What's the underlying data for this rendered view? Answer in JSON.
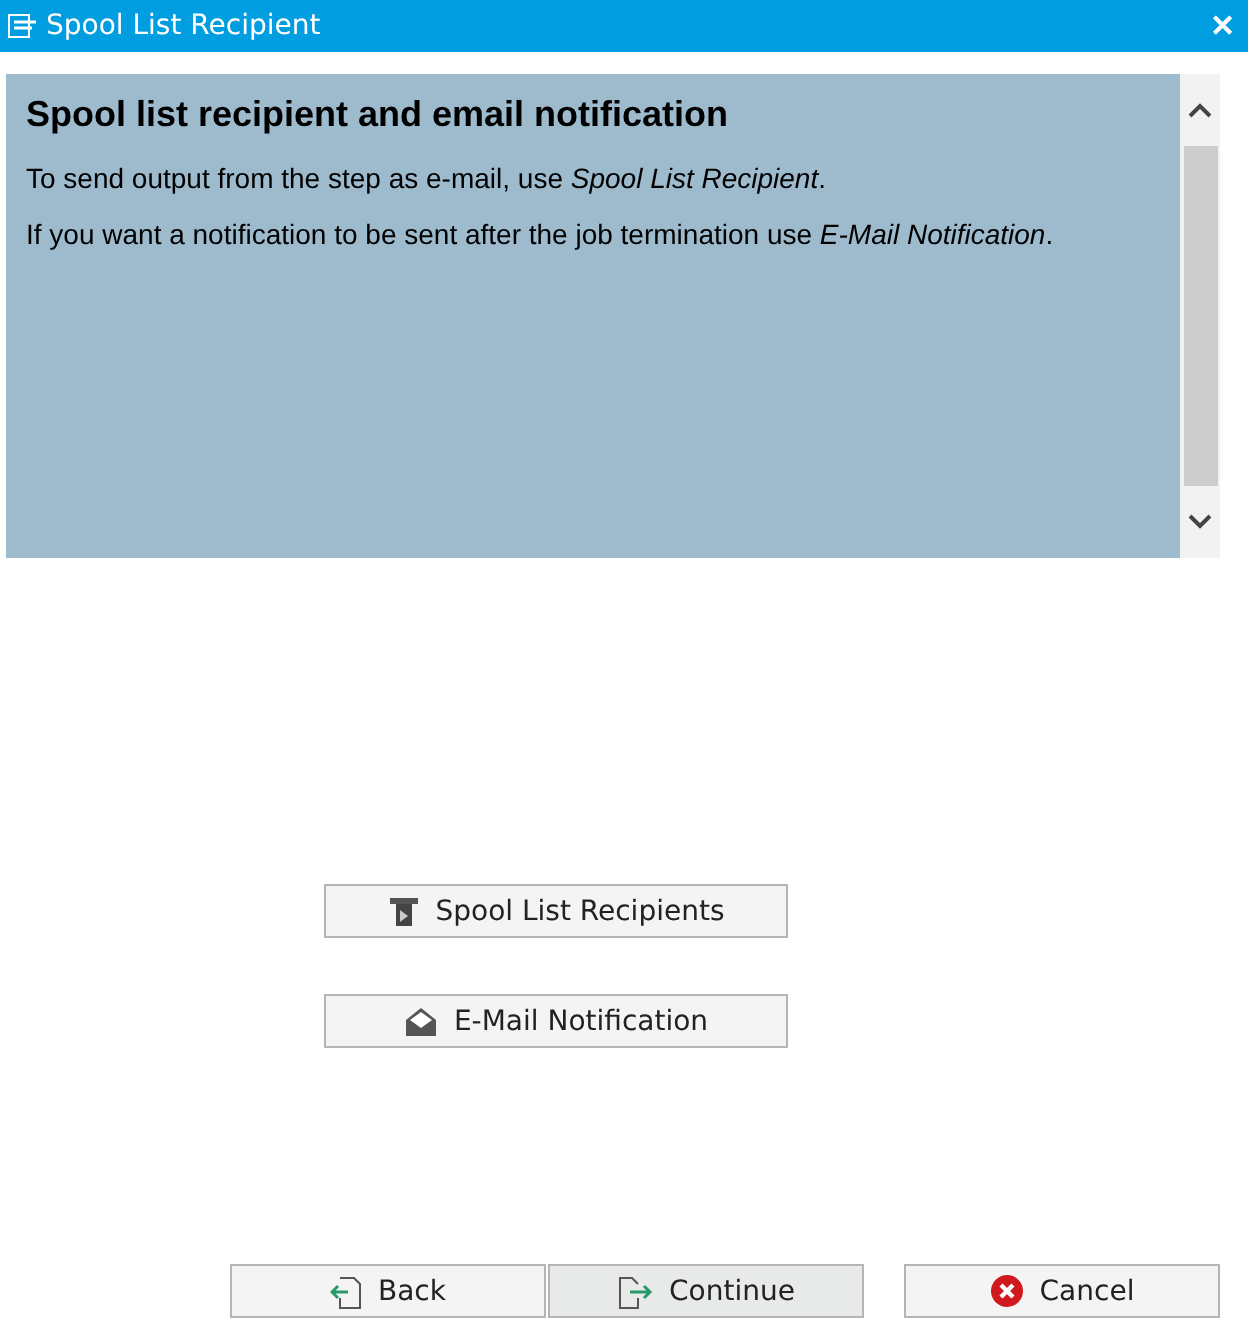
{
  "window": {
    "title": "Spool List Recipient",
    "close": "✕"
  },
  "info": {
    "heading": "Spool list recipient and email notification",
    "paragraphs": [
      "To send output from the step as e-mail, use *Spool List Recipient*.",
      "If you want a notification to be sent after the job termination use *E-Mail Notification*."
    ]
  },
  "actions": [
    {
      "kind": "spool",
      "label": "Spool List Recipients"
    },
    {
      "kind": "mail",
      "label": "E-Mail Notification"
    }
  ],
  "footer": [
    {
      "kind": "back",
      "label": "Back",
      "focused": false
    },
    {
      "kind": "continue",
      "label": "Continue",
      "focused": true
    },
    {
      "kind": "cancel",
      "label": "Cancel",
      "focused": false
    }
  ]
}
